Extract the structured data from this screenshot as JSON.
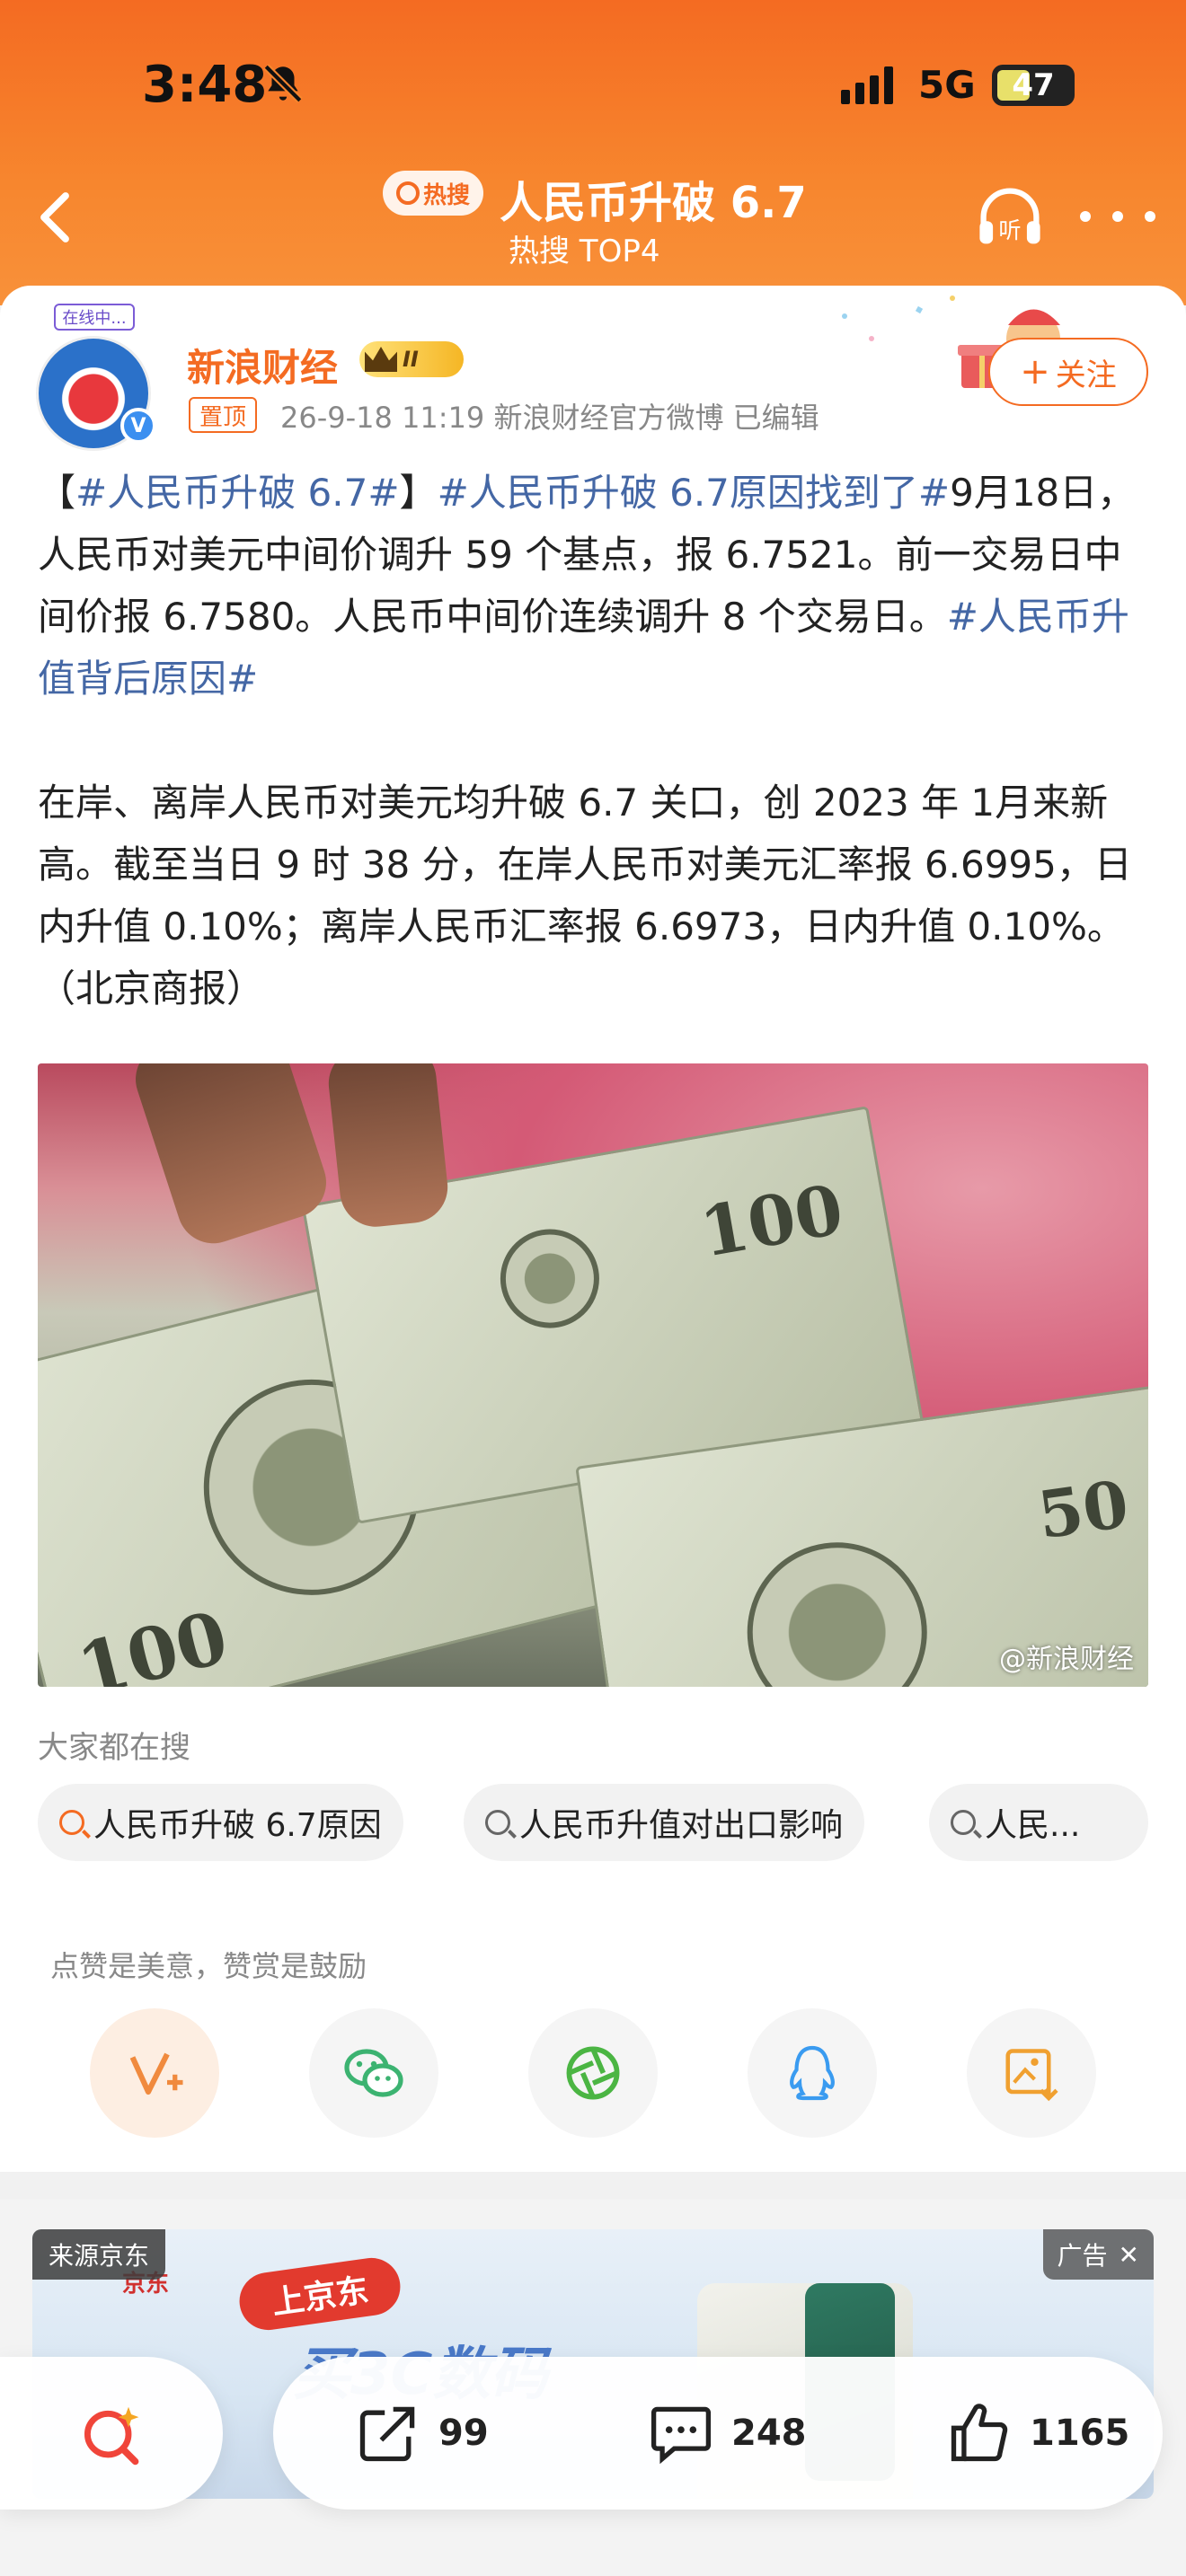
{
  "status": {
    "time": "3:48",
    "network": "5G",
    "battery": "47"
  },
  "nav": {
    "hot_badge": "热搜",
    "title": "人民币升破 6.7",
    "subtitle": "热搜 TOP4"
  },
  "post": {
    "author": "新浪财经",
    "vip_level": "II",
    "avatar_badge": "在线中...",
    "pin_tag": "置顶",
    "meta": "26-9-18 11:19  新浪财经官方微博  已编辑",
    "follow_label": "关注",
    "paragraph1": {
      "bracket_open": "【",
      "topic1": "#人民币升破 6.7#",
      "bracket_close": "】",
      "topic2": "#人民币升破 6.7原因找到了#",
      "text1": "9月18日，人民币对美元中间价调升 59 个基点，报 6.7521。前一交易日中间价报 6.7580。人民币中间价连续调升 8 个交易日。",
      "topic3": "#人民币升值背后原因#"
    },
    "paragraph2": "在岸、离岸人民币对美元均升破 6.7 关口，创 2023 年 1月来新高。截至当日 9 时 38 分，在岸人民币对美元汇率报 6.6995，日内升值 0.10%；离岸人民币汇率报 6.6973，日内升值 0.10%。（北京商报）",
    "image_watermark": "@新浪财经"
  },
  "search": {
    "title": "大家都在搜",
    "chips": [
      "人民币升破 6.7原因",
      "人民币升值对出口影响",
      "人民..."
    ]
  },
  "reward": {
    "text": "点赞是美意，赞赏是鼓励",
    "buttons": [
      "reward-icon",
      "wechat-icon",
      "moments-icon",
      "qq-icon",
      "save-image-icon"
    ]
  },
  "ad": {
    "source": "来源京东",
    "tag": "广告",
    "brand": "京东",
    "button": "上京东",
    "slogan": "买3C数码"
  },
  "actions": {
    "share_count": "99",
    "comment_count": "248",
    "like_count": "1165"
  },
  "colors": {
    "accent": "#f46b22",
    "topic": "#4467a5"
  }
}
